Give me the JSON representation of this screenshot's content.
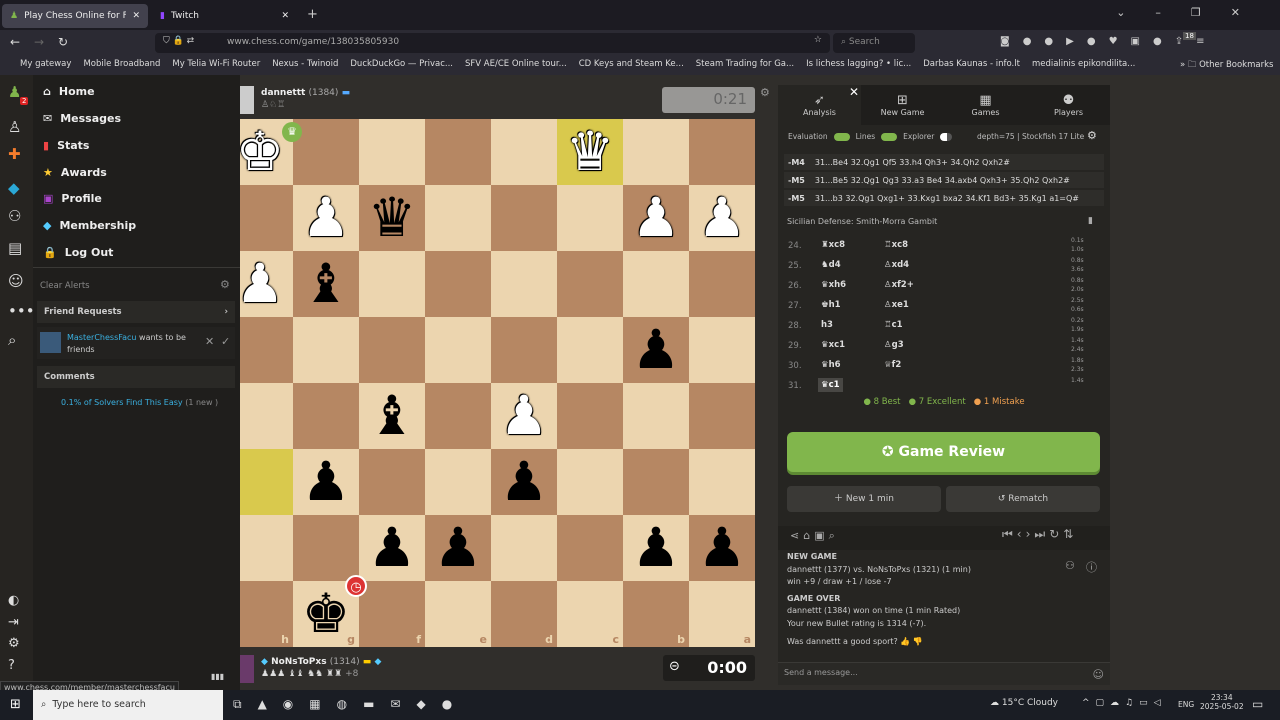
{
  "browser": {
    "tabs": [
      {
        "label": "Play Chess Online for FREE - 2 P"
      },
      {
        "label": "Twitch"
      }
    ],
    "url": "www.chess.com/game/138035805930",
    "search_placeholder": "Search",
    "badge": "18",
    "bookmarks": [
      "My gateway",
      "Mobile Broadband",
      "My Telia Wi-Fi Router",
      "Nexus - Twinoid",
      "DuckDuckGo — Privac...",
      "SFV AE/CE Online tour...",
      "CD Keys and Steam Ke...",
      "Steam Trading for Ga...",
      "Is lichess lagging? • lic...",
      "Darbas Kaunas - info.lt",
      "medialinis epikondilita..."
    ],
    "other_bookmarks": "Other Bookmarks",
    "status_url": "www.chess.com/member/masterchessfacu"
  },
  "rail": {
    "notif_badge": "2"
  },
  "menu": {
    "items": [
      "Home",
      "Messages",
      "Stats",
      "Awards",
      "Profile",
      "Membership",
      "Log Out"
    ],
    "clear_alerts": "Clear Alerts",
    "friend_requests": "Friend Requests",
    "request_user": "MasterChessFacu",
    "request_text": "wants to be friends",
    "comments": "Comments",
    "comment_link": "0.1% of Solvers Find This Easy",
    "comment_count": "(1 new )"
  },
  "top_player": {
    "name": "dannettt",
    "rating": "(1384)",
    "clock": "0:21"
  },
  "bottom_player": {
    "name": "NoNsToPxs",
    "rating": "(1314)",
    "material": "+8",
    "clock": "0:00"
  },
  "board": {
    "files": [
      "h",
      "g",
      "f",
      "e",
      "d",
      "c",
      "b",
      "a"
    ],
    "light": "#ecd5af",
    "dark": "#b68763",
    "highlight": "#d9c94d",
    "highlights": [
      "c1",
      "h6"
    ],
    "pieces": [
      {
        "sq": "h1",
        "p": "♚",
        "c": "w"
      },
      {
        "sq": "c1",
        "p": "♛",
        "c": "w"
      },
      {
        "sq": "g2",
        "p": "♟",
        "c": "w"
      },
      {
        "sq": "f2",
        "p": "♛",
        "c": "b"
      },
      {
        "sq": "b2",
        "p": "♟",
        "c": "w"
      },
      {
        "sq": "a2",
        "p": "♟",
        "c": "w"
      },
      {
        "sq": "h3",
        "p": "♟",
        "c": "w"
      },
      {
        "sq": "g3",
        "p": "♝",
        "c": "b"
      },
      {
        "sq": "b4",
        "p": "♟",
        "c": "b"
      },
      {
        "sq": "f5",
        "p": "♝",
        "c": "b"
      },
      {
        "sq": "d5",
        "p": "♟",
        "c": "w"
      },
      {
        "sq": "g6",
        "p": "♟",
        "c": "b"
      },
      {
        "sq": "d6",
        "p": "♟",
        "c": "b"
      },
      {
        "sq": "f7",
        "p": "♟",
        "c": "b"
      },
      {
        "sq": "e7",
        "p": "♟",
        "c": "b"
      },
      {
        "sq": "b7",
        "p": "♟",
        "c": "b"
      },
      {
        "sq": "a7",
        "p": "♟",
        "c": "b"
      },
      {
        "sq": "g8",
        "p": "♚",
        "c": "b"
      }
    ]
  },
  "panel": {
    "tabs": [
      "Analysis",
      "New Game",
      "Games",
      "Players"
    ],
    "toggles": [
      "Evaluation",
      "Lines",
      "Explorer"
    ],
    "engine": "depth=75 | Stockfish 17 Lite",
    "lines": [
      {
        "eval": "-M4",
        "moves": "31...Be4 32.Qg1 Qf5 33.h4 Qh3+ 34.Qh2 Qxh2#"
      },
      {
        "eval": "-M5",
        "moves": "31...Be5 32.Qg1 Qg3 33.a3 Be4 34.axb4 Qxh3+ 35.Qh2 Qxh2#"
      },
      {
        "eval": "-M5",
        "moves": "31...b3 32.Qg1 Qxg1+ 33.Kxg1 bxa2 34.Kf1 Bd3+ 35.Kg1 a1=Q#"
      }
    ],
    "opening": "Sicilian Defense: Smith-Morra Gambit",
    "moves": [
      {
        "n": "24.",
        "w": "♜xc8",
        "b": "♖xc8",
        "tw": "0.1s",
        "tb": "1.0s"
      },
      {
        "n": "25.",
        "w": "♞d4",
        "b": "♙xd4",
        "tw": "0.8s",
        "tb": "3.6s"
      },
      {
        "n": "26.",
        "w": "♛xh6",
        "b": "♙xf2+",
        "tw": "0.8s",
        "tb": "2.0s"
      },
      {
        "n": "27.",
        "w": "♚h1",
        "b": "♙xe1",
        "tw": "2.5s",
        "tb": "0.6s"
      },
      {
        "n": "28.",
        "w": "h3",
        "b": "♖c1",
        "tw": "0.2s",
        "tb": "1.9s"
      },
      {
        "n": "29.",
        "w": "♛xc1",
        "b": "♙g3",
        "tw": "1.4s",
        "tb": "2.4s"
      },
      {
        "n": "30.",
        "w": "♛h6",
        "b": "♕f2",
        "tw": "1.8s",
        "tb": "2.3s"
      },
      {
        "n": "31.",
        "w": "♛c1",
        "b": "",
        "tw": "1.4s",
        "tb": ""
      }
    ],
    "summary": {
      "best": "8 Best",
      "excellent": "7 Excellent",
      "mistake": "1 Mistake"
    },
    "game_review": "Game Review",
    "new_game": "New 1 min",
    "rematch": "Rematch",
    "chat": {
      "new_game": "NEW GAME",
      "match": "dannettt (1377) vs. NoNsToPxs (1321) (1 min)",
      "odds": "win +9 / draw +1 / lose -7",
      "game_over": "GAME OVER",
      "result": "dannettt (1384) won on time (1 min Rated)",
      "rating": "Your new Bullet rating is 1314 (-7).",
      "sport": "Was dannettt a good sport?",
      "placeholder": "Send a message..."
    }
  },
  "taskbar": {
    "search": "Type here to search",
    "weather": "15°C  Cloudy",
    "lang": "ENG",
    "time": "23:34",
    "date": "2025-05-02"
  }
}
